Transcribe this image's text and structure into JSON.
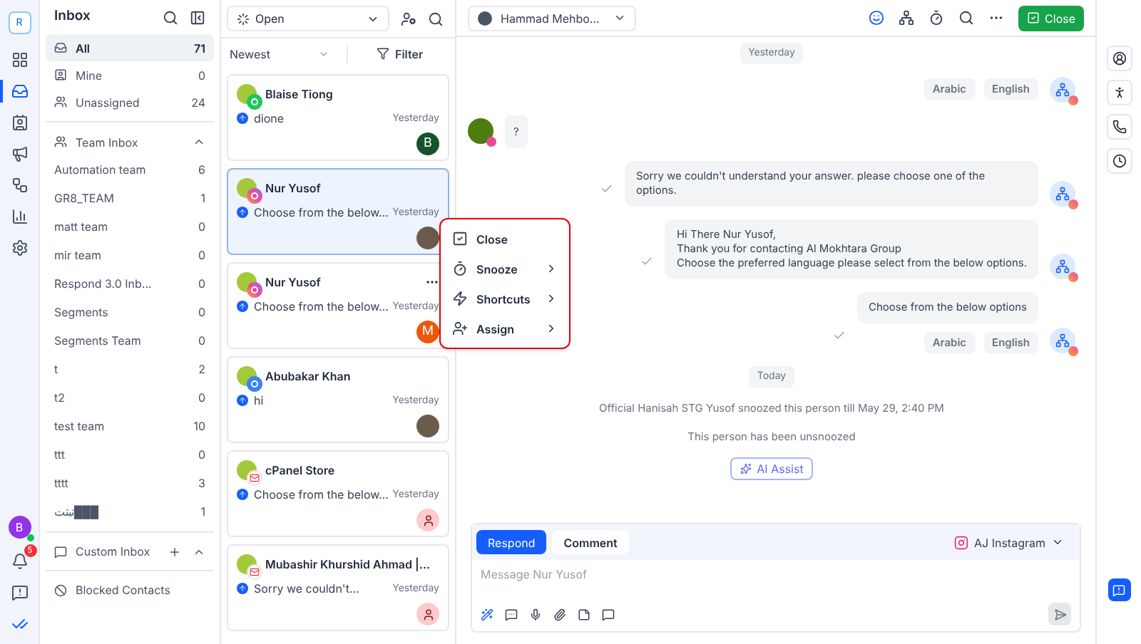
{
  "rail": {
    "workspace": "R",
    "user_initial": "B",
    "notifications": "5"
  },
  "inbox": {
    "title": "Inbox",
    "main_items": [
      {
        "label": "All",
        "count": "71",
        "selected": true
      },
      {
        "label": "Mine",
        "count": "0",
        "selected": false
      },
      {
        "label": "Unassigned",
        "count": "24",
        "selected": false
      }
    ],
    "team_inbox": {
      "title": "Team Inbox",
      "expanded": true,
      "items": [
        {
          "label": "Automation team",
          "count": "6"
        },
        {
          "label": "GR8_TEAM",
          "count": "1"
        },
        {
          "label": "matt team",
          "count": "0"
        },
        {
          "label": "mir team",
          "count": "0"
        },
        {
          "label": "Respond 3.0 Inb...",
          "count": "0"
        },
        {
          "label": "Segments",
          "count": "0"
        },
        {
          "label": "Segments Team",
          "count": "0"
        },
        {
          "label": "t",
          "count": "2"
        },
        {
          "label": "t2",
          "count": "0"
        },
        {
          "label": "test team",
          "count": "10"
        },
        {
          "label": "ttt",
          "count": "0"
        },
        {
          "label": "tttt",
          "count": "3"
        },
        {
          "label": "تبثت███",
          "count": "1"
        }
      ]
    },
    "custom_inbox": {
      "title": "Custom Inbox",
      "expanded": true
    },
    "blocked": "Blocked Contacts"
  },
  "list": {
    "status": "Open",
    "sort": "Newest",
    "filter": "Filter",
    "conversations": [
      {
        "name": "Blaise Tiong",
        "badge": {
          "kind": "whatsapp"
        },
        "preview": "dione",
        "time": "Yesterday",
        "assignee": {
          "kind": "letter",
          "text": "B",
          "color": "#14532d"
        },
        "selected": false,
        "menu": false
      },
      {
        "name": "Nur Yusof",
        "badge": {
          "kind": "instagram"
        },
        "preview": "Choose from the below...",
        "time": "Yesterday",
        "assignee": {
          "kind": "photo"
        },
        "selected": true,
        "menu": false
      },
      {
        "name": "Nur Yusof",
        "badge": {
          "kind": "instagram"
        },
        "preview": "Choose from the below...",
        "time": "Yesterday",
        "assignee": {
          "kind": "letter",
          "text": "M",
          "color": "#ea580c"
        },
        "selected": false,
        "menu": true
      },
      {
        "name": "Abubakar Khan",
        "badge": {
          "kind": "messenger"
        },
        "preview": "hi",
        "time": "Yesterday",
        "assignee": {
          "kind": "photo"
        },
        "selected": false,
        "menu": false
      },
      {
        "name": "cPanel Store",
        "badge": {
          "kind": "gmail"
        },
        "preview": "Choose from the below...",
        "time": "Yesterday",
        "assignee": {
          "kind": "person"
        },
        "selected": false,
        "menu": false
      },
      {
        "name": "Mubashir Khurshid Ahmad |...",
        "badge": {
          "kind": "gmail"
        },
        "preview": "Sorry we couldn't...",
        "time": "Yesterday",
        "assignee": {
          "kind": "person"
        },
        "selected": false,
        "menu": false
      }
    ]
  },
  "context_menu": [
    {
      "label": "Close",
      "submenu": false
    },
    {
      "label": "Snooze",
      "submenu": true
    },
    {
      "label": "Shortcuts",
      "submenu": true
    },
    {
      "label": "Assign",
      "submenu": true
    }
  ],
  "chat": {
    "contact": "Hammad Mehbo...",
    "close": "Close",
    "messages": [
      {
        "kind": "date",
        "text": "Yesterday"
      },
      {
        "kind": "buttons",
        "options": [
          "Arabic",
          "English"
        ]
      },
      {
        "kind": "incoming",
        "text": "?"
      },
      {
        "kind": "outgoing",
        "lines": [
          "Sorry we couldn't understand your answer. please choose one of the options."
        ]
      },
      {
        "kind": "outgoing",
        "lines": [
          "Hi There Nur Yusof,",
          "Thank you for contacting Al Mokhtara Group",
          "Choose the preferred language please select from the below options."
        ]
      },
      {
        "kind": "outgoing",
        "lines": [
          "Choose from the below options"
        ],
        "options": [
          "Arabic",
          "English"
        ]
      },
      {
        "kind": "date",
        "text": "Today"
      },
      {
        "kind": "event",
        "text": "Official Hanisah STG Yusof snoozed this person till May 29, 2:40 PM"
      },
      {
        "kind": "event",
        "text": "This person has been unsnoozed"
      }
    ],
    "ai_assist": "AI Assist",
    "composer": {
      "tabs": [
        {
          "label": "Respond",
          "selected": true
        },
        {
          "label": "Comment",
          "selected": false
        }
      ],
      "channel": "AJ Instagram",
      "placeholder": "Message Nur Yusof"
    }
  }
}
